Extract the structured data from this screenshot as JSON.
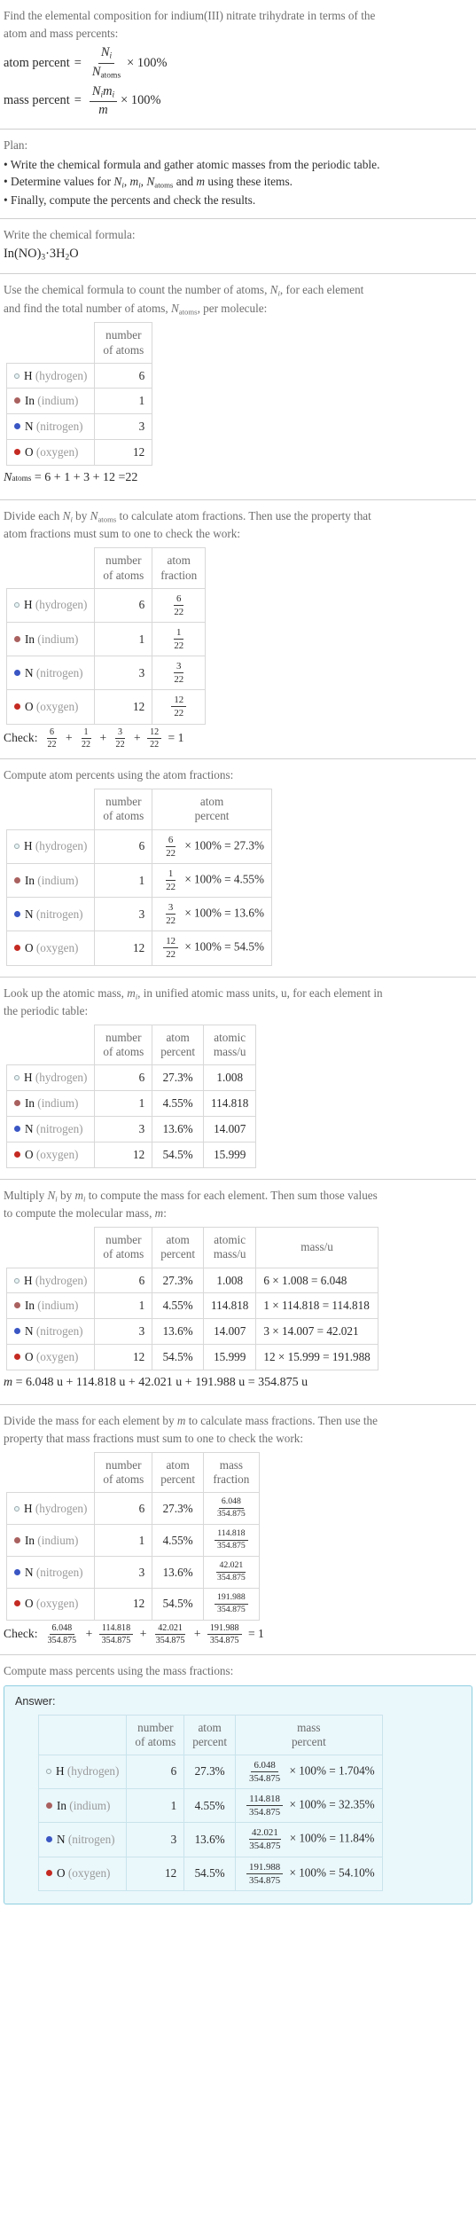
{
  "problem": {
    "statement_line1": "Find the elemental composition for indium(III) nitrate trihydrate in terms of the",
    "statement_line2": "atom and mass percents:",
    "atom_percent_label": "atom percent",
    "mass_percent_label": "mass percent",
    "equals": "=",
    "times_100": "× 100%"
  },
  "plan": {
    "heading": "Plan:",
    "bullets": [
      "• Write the chemical formula and gather atomic masses from the periodic table.",
      "• Determine values for Ni, mi, Natoms and m using these items.",
      "• Finally, compute the percents and check the results."
    ]
  },
  "formula_section": {
    "prompt": "Write the chemical formula:",
    "formula": "In(NO)3·3H2O"
  },
  "count_section": {
    "prompt_line1": "Use the chemical formula to count the number of atoms, Ni, for each element",
    "prompt_line2": "and find the total number of atoms, Natoms, per molecule:",
    "headers": {
      "blank": "",
      "number_of_atoms": "number of atoms"
    },
    "total_equation": "Natoms = 6 + 1 + 3 + 12 = 22",
    "total_value": "22"
  },
  "fraction_section": {
    "prompt_line1": "Divide each Ni by Natoms to calculate atom fractions. Then use the property that",
    "prompt_line2": "atom fractions must sum to one to check the work:",
    "headers": {
      "number_of_atoms": "number of atoms",
      "atom_fraction": "atom fraction"
    },
    "check_label": "Check:",
    "check_result": "1"
  },
  "atom_percent_section": {
    "prompt": "Compute atom percents using the atom fractions:",
    "headers": {
      "number_of_atoms": "number of atoms",
      "atom_percent": "atom percent"
    }
  },
  "atomic_mass_section": {
    "prompt_line1": "Look up the atomic mass, mi, in unified atomic mass units, u, for each element in",
    "prompt_line2": "the periodic table:",
    "headers": {
      "number_of_atoms": "number of atoms",
      "atom_percent": "atom percent",
      "atomic_mass": "atomic mass/u"
    }
  },
  "mass_section": {
    "prompt_line1": "Multiply Ni by mi to compute the mass for each element. Then sum those values",
    "prompt_line2": "to compute the molecular mass, m:",
    "headers": {
      "number_of_atoms": "number of atoms",
      "atom_percent": "atom percent",
      "atomic_mass": "atomic mass/u",
      "mass": "mass/u"
    },
    "molecular_mass_equation": "m = 6.048 u + 114.818 u + 42.021 u + 191.988 u = 354.875 u",
    "molecular_mass": "354.875"
  },
  "mass_fraction_section": {
    "prompt_line1": "Divide the mass for each element by m to calculate mass fractions. Then use the",
    "prompt_line2": "property that mass fractions must sum to one to check the work:",
    "headers": {
      "number_of_atoms": "number of atoms",
      "atom_percent": "atom percent",
      "mass_fraction": "mass fraction"
    },
    "check_label": "Check:",
    "check_result": "1"
  },
  "mass_percent_section": {
    "prompt": "Compute mass percents using the mass fractions:",
    "answer_label": "Answer:",
    "headers": {
      "number_of_atoms": "number of atoms",
      "atom_percent": "atom percent",
      "mass_percent": "mass percent"
    }
  },
  "colors": {
    "hydrogen": "#e8f5f7",
    "hydrogen_border": "#9aa7ab",
    "indium": "#a9615f",
    "nitrogen": "#3a56c4",
    "oxygen": "#c42a22",
    "answer_bg": "#eaf7fb",
    "answer_border": "#8fcfe0"
  },
  "elements": [
    {
      "symbol": "H",
      "name": "(hydrogen)",
      "color_key": "hydrogen",
      "count": "6",
      "fraction_num": "6",
      "fraction_den": "22",
      "atom_percent": "27.3%",
      "atomic_mass": "1.008",
      "mass_expr_lhs": "6 × 1.008",
      "mass_value": "6.048",
      "mass_frac_num": "6.048",
      "mass_frac_den": "354.875",
      "mass_percent": "1.704%"
    },
    {
      "symbol": "In",
      "name": "(indium)",
      "color_key": "indium",
      "count": "1",
      "fraction_num": "1",
      "fraction_den": "22",
      "atom_percent": "4.55%",
      "atomic_mass": "114.818",
      "mass_expr_lhs": "1 × 114.818",
      "mass_value": "114.818",
      "mass_frac_num": "114.818",
      "mass_frac_den": "354.875",
      "mass_percent": "32.35%"
    },
    {
      "symbol": "N",
      "name": "(nitrogen)",
      "color_key": "nitrogen",
      "count": "3",
      "fraction_num": "3",
      "fraction_den": "22",
      "atom_percent": "13.6%",
      "atomic_mass": "14.007",
      "mass_expr_lhs": "3 × 14.007",
      "mass_value": "42.021",
      "mass_frac_num": "42.021",
      "mass_frac_den": "354.875",
      "mass_percent": "11.84%"
    },
    {
      "symbol": "O",
      "name": "(oxygen)",
      "color_key": "oxygen",
      "count": "12",
      "fraction_num": "12",
      "fraction_den": "22",
      "atom_percent": "54.5%",
      "atomic_mass": "15.999",
      "mass_expr_lhs": "12 × 15.999",
      "mass_value": "191.988",
      "mass_frac_num": "191.988",
      "mass_frac_den": "354.875",
      "mass_percent": "54.10%"
    }
  ],
  "symbols": {
    "times_100_pct": "× 100%",
    "equals": "=",
    "plus": "+",
    "times": "×",
    "unit_u": "u"
  }
}
